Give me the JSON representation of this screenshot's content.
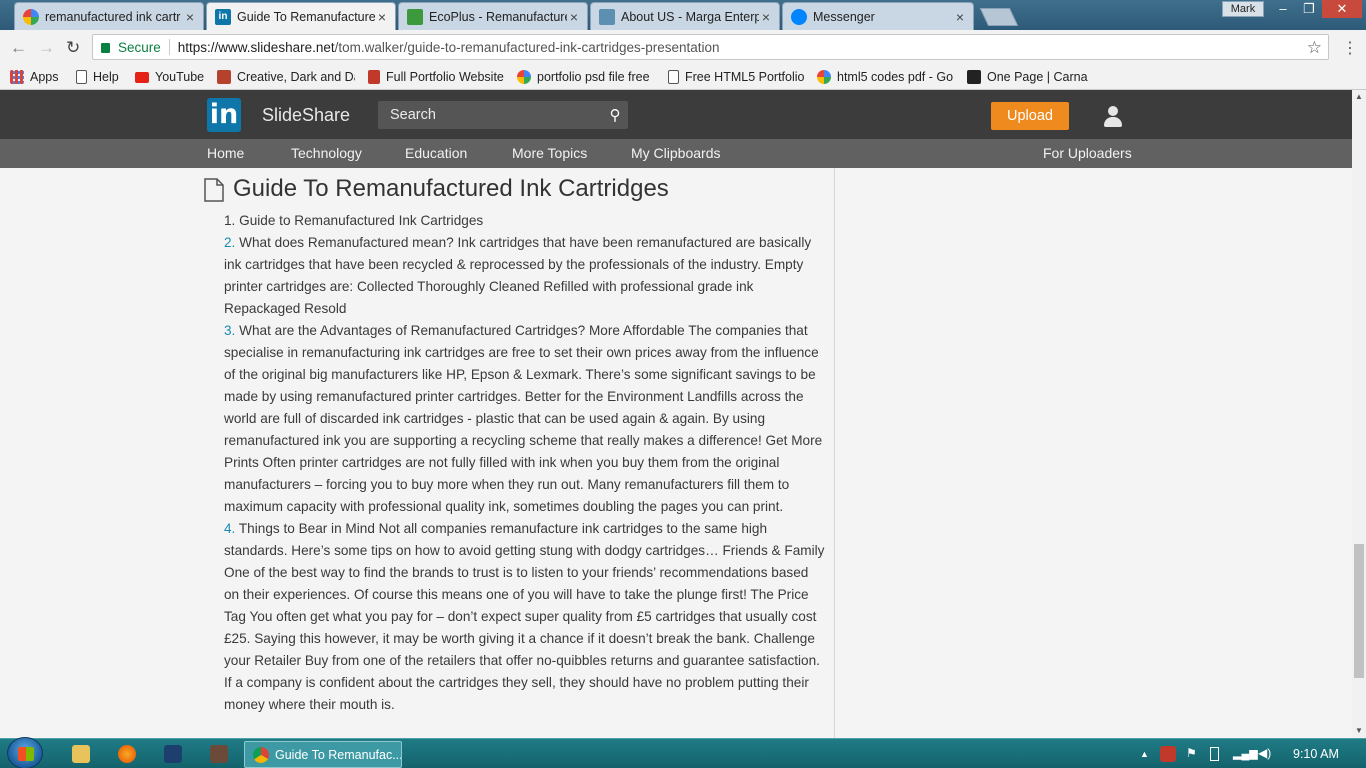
{
  "browser": {
    "tabs": [
      {
        "title": "remanufactured ink cartr",
        "favicon": "google-icon",
        "active": false
      },
      {
        "title": "Guide To Remanufacture",
        "favicon": "linkedin-icon",
        "active": true
      },
      {
        "title": "EcoPlus - Remanufacture",
        "favicon": "ecoplus-icon",
        "active": false
      },
      {
        "title": "About US - Marga Enterp",
        "favicon": "marga-icon",
        "active": false
      },
      {
        "title": "Messenger",
        "favicon": "messenger-icon",
        "active": false
      }
    ],
    "user_badge": "Mark",
    "window_controls": {
      "minimize": "–",
      "maximize": "❐",
      "close": "✕"
    },
    "secure_label": "Secure",
    "url_domain": "https://www.slideshare.net",
    "url_path": "/tom.walker/guide-to-remanufactured-ink-cartridges-presentation",
    "bookmarks": [
      {
        "label": "Apps",
        "icon": "apps-grid-icon"
      },
      {
        "label": "Help",
        "icon": "page-icon"
      },
      {
        "label": "YouTube",
        "icon": "youtube-icon"
      },
      {
        "label": "Creative, Dark and Da",
        "icon": "creative-icon"
      },
      {
        "label": "Full Portfolio Website",
        "icon": "portfolio-icon"
      },
      {
        "label": "portfolio psd file free",
        "icon": "google-icon"
      },
      {
        "label": "Free HTML5 Portfolio",
        "icon": "page-icon"
      },
      {
        "label": "html5 codes pdf - Go",
        "icon": "google-icon"
      },
      {
        "label": "One Page | Carna",
        "icon": "carna-icon"
      }
    ]
  },
  "header": {
    "logo_letters": "in",
    "logo_text": "SlideShare",
    "search_label": "Search",
    "upload_label": "Upload"
  },
  "nav": {
    "items": [
      "Home",
      "Technology",
      "Education",
      "More Topics",
      "My Clipboards"
    ],
    "right_item": "For Uploaders"
  },
  "document": {
    "title": "Guide To Remanufactured Ink Cartridges",
    "slides": [
      {
        "num": "1.",
        "text": "Guide to Remanufactured Ink Cartridges"
      },
      {
        "num": "2.",
        "text": "What does Remanufactured mean? Ink cartridges that have been remanufactured are basically ink cartridges that have been recycled & reprocessed by the professionals of the industry. Empty printer cartridges are: Collected Thoroughly Cleaned Refilled with professional grade ink Repackaged Resold"
      },
      {
        "num": "3.",
        "text": "What are the Advantages of Remanufactured Cartridges? More Affordable The companies that specialise in remanufacturing ink cartridges are free to set their own prices away from the influence of the original big manufacturers like HP, Epson & Lexmark. There’s some significant savings to be made by using remanufactured printer cartridges. Better for the Environment Landfills across the world are full of discarded ink cartridges - plastic that can be used again & again. By using remanufactured ink you are supporting a recycling scheme that really makes a difference! Get More Prints Often printer cartridges are not fully filled with ink when you buy them from the original manufacturers – forcing you to buy more when they run out. Many remanufacturers fill them to maximum capacity with professional quality ink, sometimes doubling the pages you can print."
      },
      {
        "num": "4.",
        "text": "Things to Bear in Mind Not all companies remanufacture ink cartridges to the same high standards. Here’s some tips on how to avoid getting stung with dodgy cartridges… Friends & Family One of the best way to find the brands to trust is to listen to your friends’ recommendations based on their experiences. Of course this means one of you will have to take the plunge first! The Price Tag You often get what you pay for – don’t expect super quality from £5 cartridges that usually cost £25. Saying this however, it may be worth giving it a chance if it doesn’t break the bank. Challenge your Retailer Buy from one of the retailers that offer no-quibbles returns and guarantee satisfaction. If a company is confident about the cartridges they sell, they should have no problem putting their money where their mouth is."
      }
    ]
  },
  "taskbar": {
    "active_app_label": "Guide To Remanufac...",
    "clock": "9:10 AM"
  },
  "colors": {
    "accent_upload": "#ef8a1e",
    "linkedin_blue": "#0e76a8",
    "slide_number": "#1b8bb5",
    "secure_green": "#0b8043"
  }
}
